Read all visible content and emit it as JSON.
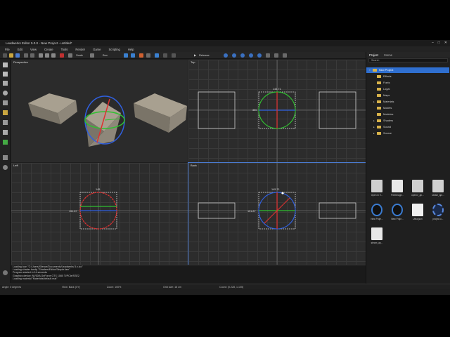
{
  "window": {
    "title": "Leadwerks Editor 5.0.0 - New Project - untitled*"
  },
  "menu": [
    "File",
    "Edit",
    "View",
    "Create",
    "Tools",
    "Render",
    "Game",
    "Scripting",
    "Help"
  ],
  "toolbar": {
    "zoom_label": "Scale",
    "box_label": "Box",
    "run_label": "Release"
  },
  "viewports": {
    "perspective": "Perspective",
    "top": "Top",
    "left": "Left",
    "back": "Back"
  },
  "dims": {
    "top_w": "144.71",
    "top_h": "350",
    "left_w": "145",
    "left_h": "151.87",
    "back_w": "145.71",
    "back_h": "151.87"
  },
  "console": [
    "Loading icon \"C:/Users/Xilence/Documents/Leadwerks 5.x.ico\"",
    "Loading shader family \"Shaders/Editor/Simple.fam\"",
    "Program started in 14 seconds",
    "Graphics device: NVIDIA GeForce GTX 1080 Ti/PCIe/SSE2",
    "Loading material \"Materials/default.mat\""
  ],
  "status": {
    "angle": "Angle: 0 degrees",
    "view": "View: Back (XY)",
    "zoom": "Zoom: 100%",
    "grid": "Grid size: 16 cm",
    "coords": "Coord: (0.228, 1.105)"
  },
  "panel": {
    "tabs": [
      "Project",
      "Scene"
    ],
    "search_placeholder": "Search",
    "tree": [
      {
        "label": "New Project",
        "sel": true,
        "indent": 0,
        "arrow": "▾"
      },
      {
        "label": "Effects",
        "indent": 1,
        "arrow": ""
      },
      {
        "label": "Fonts",
        "indent": 1,
        "arrow": ""
      },
      {
        "label": "Logal",
        "indent": 1,
        "arrow": ""
      },
      {
        "label": "Maps",
        "indent": 1,
        "arrow": ""
      },
      {
        "label": "Materials",
        "indent": 1,
        "arrow": "▸"
      },
      {
        "label": "Models",
        "indent": 1,
        "arrow": ""
      },
      {
        "label": "Modules",
        "indent": 1,
        "arrow": ""
      },
      {
        "label": "Shaders",
        "indent": 1,
        "arrow": "▸"
      },
      {
        "label": "Sound",
        "indent": 1,
        "arrow": "▸"
      },
      {
        "label": "Source",
        "indent": 1,
        "arrow": "▸"
      }
    ],
    "files": [
      {
        "name": "Open in V...",
        "kind": "gear"
      },
      {
        "name": "FreeImage...",
        "kind": "doc"
      },
      {
        "name": "openvr_ap...",
        "kind": "gear"
      },
      {
        "name": "steam_api...",
        "kind": "gear"
      },
      {
        "name": "New Proje...",
        "kind": "logo"
      },
      {
        "name": "New Proje...",
        "kind": "logo"
      },
      {
        "name": "Ultra.json",
        "kind": "json"
      },
      {
        "name": "project.u...",
        "kind": "ultra"
      },
      {
        "name": "steam_ap...",
        "kind": "doc"
      }
    ]
  },
  "colors": {
    "accent": "#2f6fd0",
    "red_axis": "#e03030",
    "green_axis": "#30c030",
    "blue_axis": "#3060e0"
  }
}
